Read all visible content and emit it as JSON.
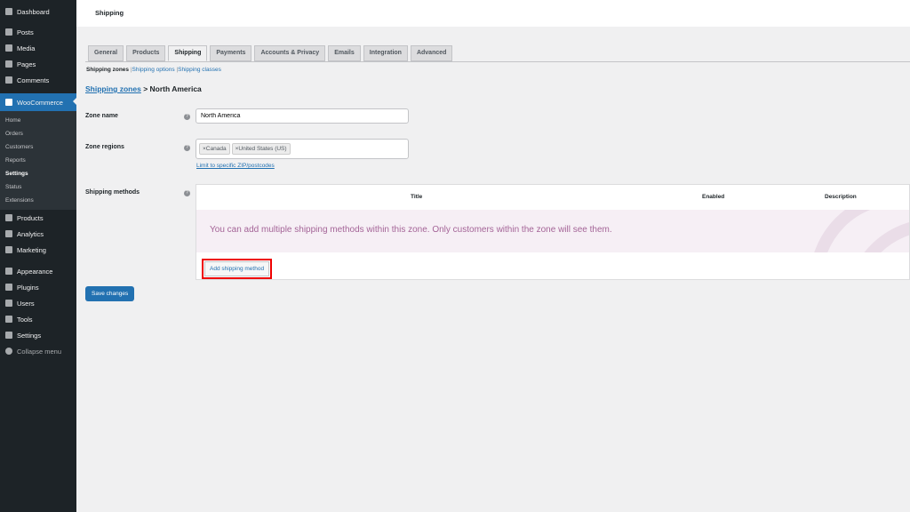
{
  "sidebar": {
    "items": [
      "Dashboard",
      "Posts",
      "Media",
      "Pages",
      "Comments"
    ],
    "woo": "WooCommerce",
    "woo_sub": [
      "Home",
      "Orders",
      "Customers",
      "Reports",
      "Settings",
      "Status",
      "Extensions"
    ],
    "items2": [
      "Products",
      "Analytics",
      "Marketing"
    ],
    "items3": [
      "Appearance",
      "Plugins",
      "Users",
      "Tools",
      "Settings",
      "Collapse menu"
    ]
  },
  "header": {
    "title": "Shipping"
  },
  "tabs": [
    "General",
    "Products",
    "Shipping",
    "Payments",
    "Accounts & Privacy",
    "Emails",
    "Integration",
    "Advanced"
  ],
  "subnav": {
    "zones": "Shipping zones",
    "options": "Shipping options",
    "classes": "Shipping classes",
    "sep": "|"
  },
  "breadcrumb": {
    "link": "Shipping zones",
    "current": "> North America"
  },
  "form": {
    "zone_name_label": "Zone name",
    "zone_name_value": "North America",
    "zone_regions_label": "Zone regions",
    "regions": [
      "Canada",
      "United States (US)"
    ],
    "limit_link": "Limit to specific ZIP/postcodes",
    "methods_label": "Shipping methods",
    "help": "?",
    "remove": "×"
  },
  "table": {
    "cols": [
      "Title",
      "Enabled",
      "Description"
    ],
    "blank": "You can add multiple shipping methods within this zone. Only customers within the zone will see them.",
    "add_button": "Add shipping method"
  },
  "save_button": "Save changes"
}
